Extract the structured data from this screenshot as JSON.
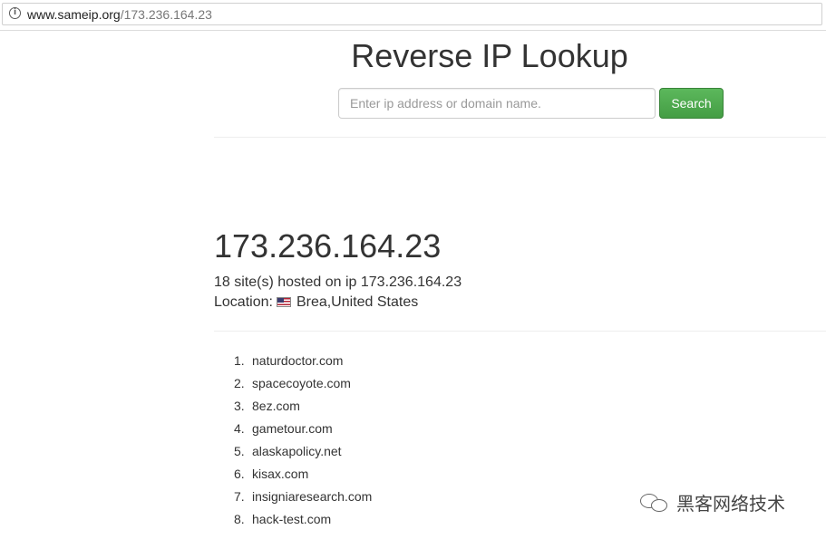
{
  "browser": {
    "url_host": "www.sameip.org",
    "url_path": "/173.236.164.23"
  },
  "header": {
    "title": "Reverse IP Lookup",
    "search_placeholder": "Enter ip address or domain name.",
    "search_button_label": "Search",
    "accent_color": "#449d44"
  },
  "result": {
    "ip": "173.236.164.23",
    "hosted_summary": "18 site(s) hosted on ip 173.236.164.23",
    "location_label": "Location:",
    "location_value": "Brea,United States",
    "flag_icon": "us-flag-icon"
  },
  "sites": [
    {
      "num": "1.",
      "name": "naturdoctor.com"
    },
    {
      "num": "2.",
      "name": "spacecoyote.com"
    },
    {
      "num": "3.",
      "name": "8ez.com"
    },
    {
      "num": "4.",
      "name": "gametour.com"
    },
    {
      "num": "5.",
      "name": "alaskapolicy.net"
    },
    {
      "num": "6.",
      "name": "kisax.com"
    },
    {
      "num": "7.",
      "name": "insigniaresearch.com"
    },
    {
      "num": "8.",
      "name": "hack-test.com"
    }
  ],
  "watermark": {
    "text": "黑客网络技术",
    "icon": "wechat-icon"
  }
}
